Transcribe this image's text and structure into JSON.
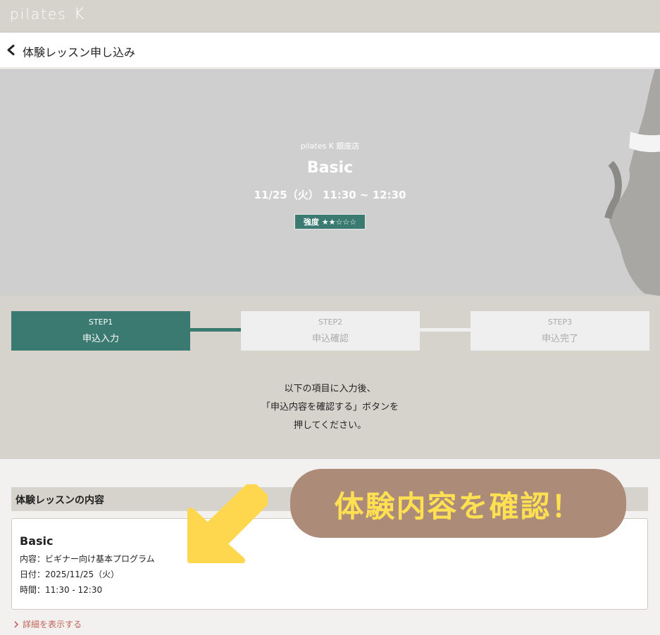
{
  "header": {
    "logo_text": "pilates",
    "logo_k": "K"
  },
  "nav": {
    "title": "体験レッスン申し込み"
  },
  "hero": {
    "studio": "pilates K 銀座店",
    "lesson_name": "Basic",
    "datetime": "11/25（火） 11:30 ~ 12:30",
    "intensity_badge": "強度 ★★☆☆☆"
  },
  "steps": [
    {
      "number": "STEP1",
      "label": "申込入力",
      "state": "active"
    },
    {
      "number": "STEP2",
      "label": "申込確認",
      "state": "inactive"
    },
    {
      "number": "STEP3",
      "label": "申込完了",
      "state": "inactive"
    }
  ],
  "instructions": {
    "line1": "以下の項目に入力後、",
    "line2": "「申込内容を確認する」ボタンを",
    "line3": "押してください。"
  },
  "details": {
    "section_title": "体験レッスンの内容",
    "lesson_name": "Basic",
    "content_line": "内容：ビギナー向け基本プログラム",
    "date_line": "日付：2025/11/25（火）",
    "time_line": "時間：11:30 - 12:30",
    "show_more": "詳細を表示する"
  },
  "callout": {
    "text": "体験内容を確認！"
  },
  "colors": {
    "accent_green": "#3a7a70",
    "beige": "#d6d2cc",
    "callout_bg": "#ac8c79",
    "callout_text": "#ffe052",
    "arrow": "#ffd74f",
    "link_red": "#c3645a"
  }
}
